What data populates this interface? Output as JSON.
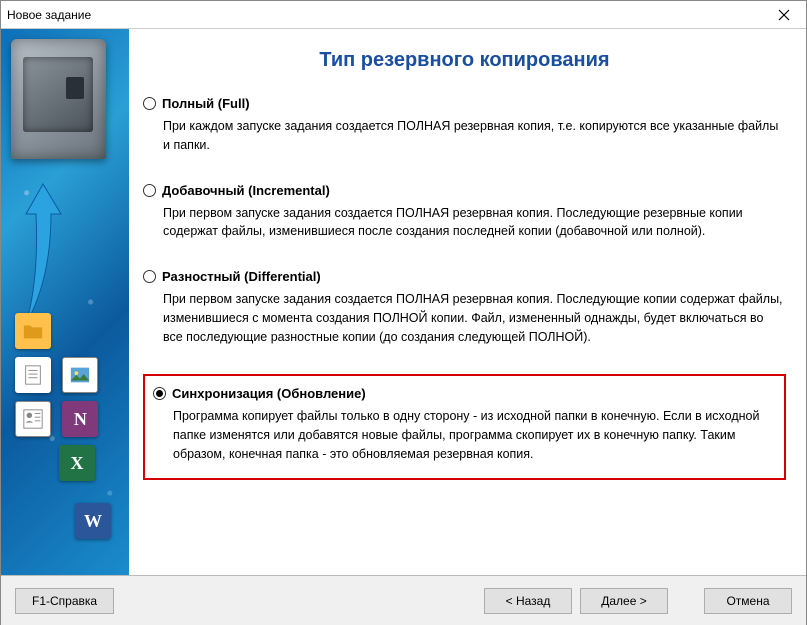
{
  "window": {
    "title": "Новое задание"
  },
  "heading": "Тип резервного копирования",
  "options": [
    {
      "title": "Полный (Full)",
      "desc": "При каждом запуске задания создается ПОЛНАЯ резервная копия, т.е. копируются все указанные файлы и папки.",
      "selected": false
    },
    {
      "title": "Добавочный (Incremental)",
      "desc": "При первом запуске задания создается ПОЛНАЯ резервная копия. Последующие резервные копии содержат файлы, изменившиеся после создания последней копии (добавочной или полной).",
      "selected": false
    },
    {
      "title": "Разностный (Differential)",
      "desc": "При первом запуске задания создается ПОЛНАЯ резервная копия. Последующие копии содержат файлы, изменившиеся с момента создания ПОЛНОЙ копии. Файл, измененный однажды, будет включаться во все последующие разностные копии (до создания следующей ПОЛНОЙ).",
      "selected": false
    },
    {
      "title": "Синхронизация (Обновление)",
      "desc": "Программа копирует файлы только в одну сторону - из исходной папки в конечную. Если в исходной папке изменятся или добавятся новые файлы, программа скопирует их в конечную папку. Таким образом, конечная папка - это обновляемая резервная копия.",
      "selected": true
    }
  ],
  "buttons": {
    "help": "F1-Справка",
    "back": "< Назад",
    "next": "Далее >",
    "cancel": "Отмена"
  },
  "sidebar_icons": {
    "folder": "folder-icon",
    "document": "document-icon",
    "picture": "picture-icon",
    "contact": "contact-icon",
    "onenote": "N",
    "excel": "X",
    "word": "W"
  }
}
